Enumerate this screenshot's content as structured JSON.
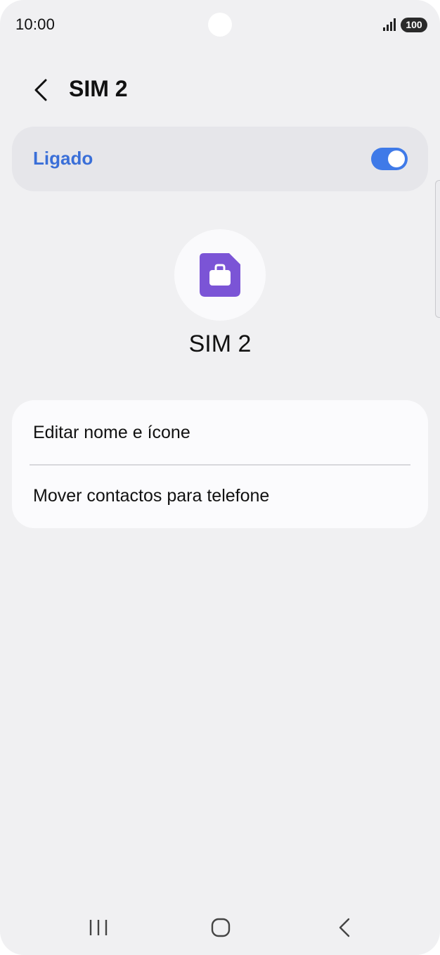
{
  "status_bar": {
    "time": "10:00",
    "battery": "100",
    "signal_icon": "signal-icon"
  },
  "header": {
    "back_icon": "chevron-left-icon",
    "title": "SIM 2"
  },
  "master_switch": {
    "label": "Ligado",
    "state": "on",
    "accent_color": "#3f7ae8"
  },
  "sim": {
    "icon": "briefcase-sim-icon",
    "icon_color": "#7b54d6",
    "name": "SIM 2"
  },
  "options": [
    {
      "label": "Editar nome e ícone"
    },
    {
      "label": "Mover contactos para telefone"
    }
  ],
  "navigation_bar": {
    "recents_icon": "recents-icon",
    "home_icon": "home-icon",
    "back_icon": "back-icon"
  }
}
